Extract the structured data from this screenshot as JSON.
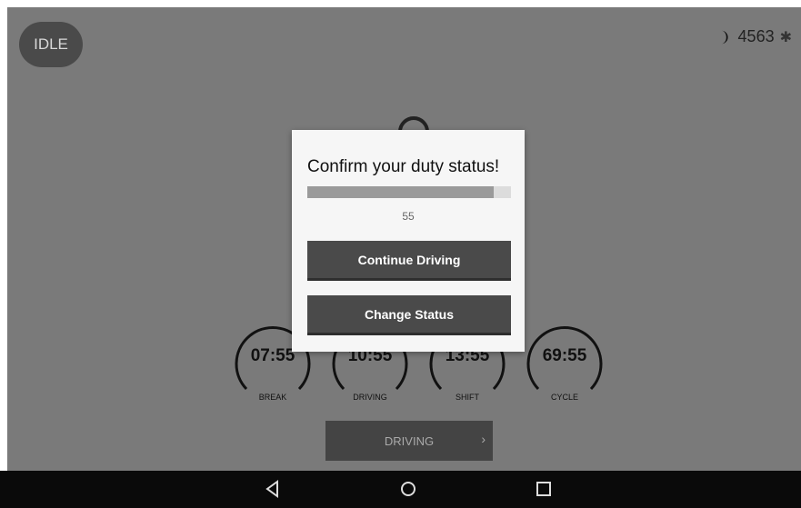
{
  "top": {
    "idle_label": "IDLE",
    "count": "4563"
  },
  "dialog": {
    "title": "Confirm your duty status!",
    "progress_fraction": 0.915,
    "countdown": "55",
    "continue_label": "Continue Driving",
    "change_label": "Change Status"
  },
  "gauges": [
    {
      "time": "07:55",
      "label": "BREAK"
    },
    {
      "time": "10:55",
      "label": "DRIVING"
    },
    {
      "time": "13:55",
      "label": "SHIFT"
    },
    {
      "time": "69:55",
      "label": "CYCLE"
    }
  ],
  "bottom": {
    "status_label": "DRIVING"
  },
  "icons": [
    "moon-icon",
    "bluetooth-icon",
    "chevron-right-icon",
    "nav-back-icon",
    "nav-home-icon",
    "nav-recents-icon"
  ]
}
